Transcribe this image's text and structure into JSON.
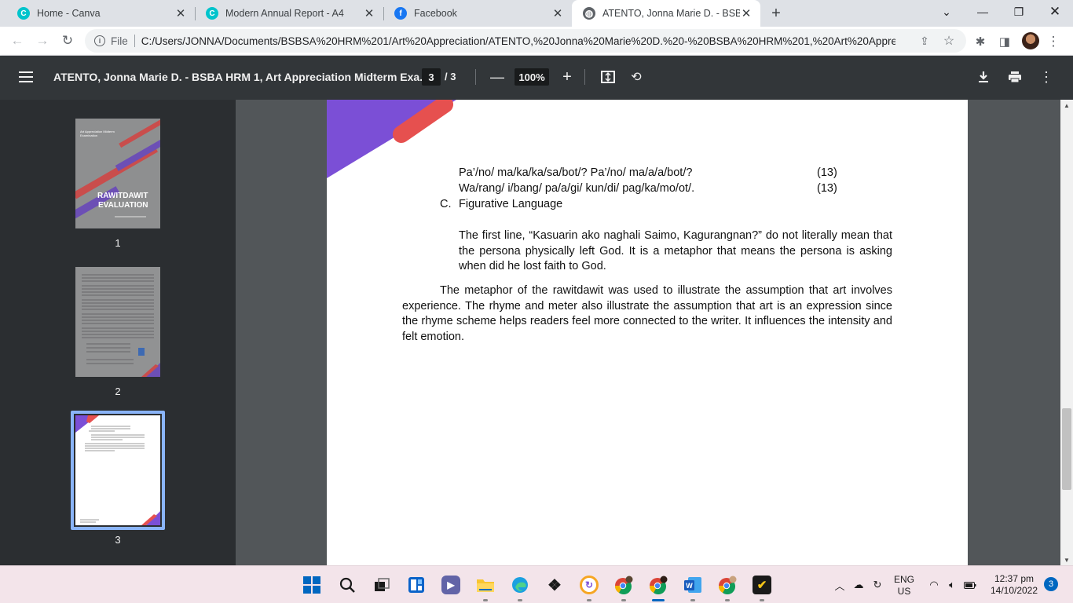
{
  "browser": {
    "tabs": [
      {
        "title": "Home - Canva",
        "favicon": "canva-icon",
        "color": "#00c4cc",
        "glyph": "C"
      },
      {
        "title": "Modern Annual Report - A4",
        "favicon": "canva-icon",
        "color": "#00c4cc",
        "glyph": "C"
      },
      {
        "title": "Facebook",
        "favicon": "facebook-icon",
        "color": "#1877f2",
        "glyph": "f"
      },
      {
        "title": "ATENTO, Jonna Marie D. - BSBA H",
        "favicon": "globe-icon",
        "color": "#5f6368",
        "glyph": "◍"
      }
    ],
    "active_tab": 3,
    "address": {
      "scheme": "File",
      "url": "C:/Users/JONNA/Documents/BSBSA%20HRM%201/Art%20Appreciation/ATENTO,%20Jonna%20Marie%20D.%20-%20BSBA%20HRM%201,%20Art%20Appre..."
    }
  },
  "pdf_viewer": {
    "title": "ATENTO, Jonna Marie D. - BSBA HRM 1, Art Appreciation Midterm Exa...",
    "current_page": "3",
    "total_pages": "/ 3",
    "zoom": "100%",
    "thumbnails": [
      {
        "number": "1",
        "heading_line1": "RAWITDAWIT",
        "heading_line2": "EVALUATION",
        "small_title": "Art Appreciation Midterm Examination"
      },
      {
        "number": "2"
      },
      {
        "number": "3"
      }
    ],
    "active_thumbnail": 3
  },
  "document": {
    "lines": [
      {
        "text": "Pa’/no/ ma/ka/ka/sa/bot/? Pa’/no/ ma/a/a/bot/?",
        "count": "(13)"
      },
      {
        "text": "Wa/rang/ i/bang/ pa/a/gi/ kun/di/ pag/ka/mo/ot/.",
        "count": "(13)"
      }
    ],
    "section_letter": "C.",
    "section_title": "Figurative Language",
    "figurative_paragraph": "The first line, “Kasuarin ako naghali Saimo, Kagurangnan?” do not literally mean that the persona physically left God. It is a metaphor that means the persona is asking when did he lost faith to God.",
    "conclusion_paragraph": "The metaphor of the rawitdawit was used to illustrate the assumption that art involves experience. The rhyme and meter also illustrate the assumption that art is an expression since the rhyme scheme helps readers feel more connected to the writer. It influences the intensity and felt emotion."
  },
  "taskbar": {
    "apps": [
      "windows-start-icon",
      "search-icon",
      "task-view-icon",
      "widgets-icon",
      "teams-chat-icon",
      "file-explorer-icon",
      "edge-icon",
      "dropbox-icon",
      "app-circle-icon",
      "chrome-profile-1-icon",
      "chrome-profile-2-icon",
      "word-icon",
      "chrome-profile-3-icon",
      "norton-icon"
    ],
    "language": "ENG",
    "region": "US",
    "time": "12:37 pm",
    "date": "14/10/2022",
    "notifications": "3"
  },
  "colors": {
    "accent_purple": "#7b4fd6",
    "accent_coral": "#e6504f",
    "pdf_toolbar": "#323639",
    "doc_background": "#525659"
  }
}
